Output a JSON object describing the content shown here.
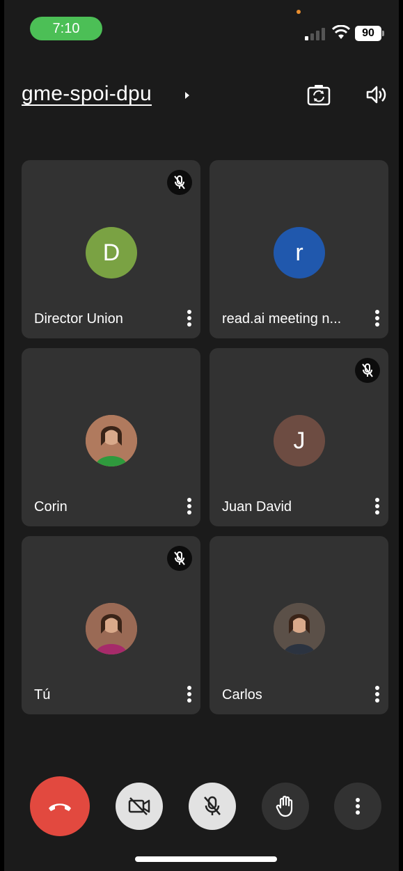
{
  "status_bar": {
    "time": "7:10",
    "battery": "90"
  },
  "header": {
    "meeting_code": "gme-spoi-dpu",
    "icons": [
      "chevron-right-icon",
      "switch-camera-icon",
      "speaker-icon"
    ]
  },
  "participants": [
    {
      "name": "Director Union",
      "initial": "D",
      "avatar_color": "#7aa243",
      "muted": true,
      "photo": false
    },
    {
      "name": "read.ai meeting n...",
      "initial": "r",
      "avatar_color": "#2058ad",
      "muted": false,
      "photo": false
    },
    {
      "name": "Corin",
      "initial": "",
      "avatar_color": "#b07a5e",
      "muted": false,
      "photo": true
    },
    {
      "name": "Juan David",
      "initial": "J",
      "avatar_color": "#6d4c42",
      "muted": true,
      "photo": false
    },
    {
      "name": "Tú",
      "initial": "",
      "avatar_color": "#9a6a55",
      "muted": true,
      "photo": true
    },
    {
      "name": "Carlos",
      "initial": "",
      "avatar_color": "#5b5048",
      "muted": false,
      "photo": true
    }
  ],
  "controls": {
    "icons": [
      "end-call-icon",
      "camera-off-icon",
      "mic-off-icon",
      "raise-hand-icon",
      "more-options-icon"
    ],
    "end_call_color": "#e2493f"
  }
}
